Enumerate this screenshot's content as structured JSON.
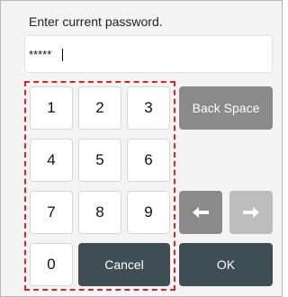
{
  "dialog": {
    "prompt": "Enter current password.",
    "password_value": "*****"
  },
  "keypad": {
    "digits": [
      "1",
      "2",
      "3",
      "4",
      "5",
      "6",
      "7",
      "8",
      "9",
      "0"
    ],
    "cancel_label": "Cancel",
    "backspace_label": "Back Space",
    "ok_label": "OK",
    "left_arrow_icon": "arrow-left-icon",
    "right_arrow_icon": "arrow-right-icon"
  },
  "colors": {
    "dark_button": "#3e4e54",
    "gray_button": "#8a8a8a",
    "disabled_button": "#bdbdbd",
    "highlight_outline": "#e02424"
  }
}
